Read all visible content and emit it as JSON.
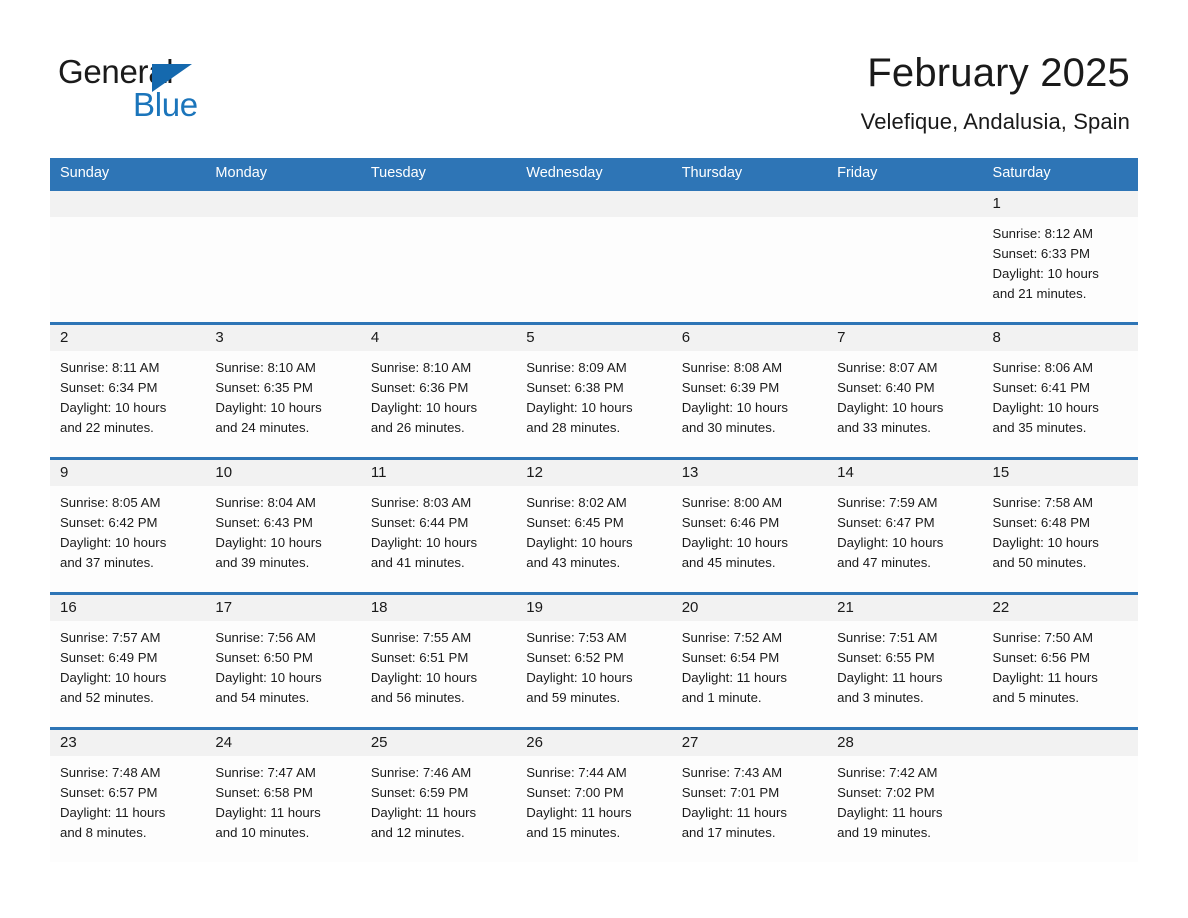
{
  "brand": {
    "name_part1": "General",
    "name_part2": "Blue",
    "colors": {
      "blue": "#1b75bb",
      "triangle": "#1569ae"
    }
  },
  "header": {
    "month_title": "February 2025",
    "location": "Velefique, Andalusia, Spain"
  },
  "theme": {
    "header_blue": "#2e75b6",
    "day_band_gray": "#f2f2f2",
    "text": "#1a1a1a"
  },
  "calendar": {
    "weekdays": [
      "Sunday",
      "Monday",
      "Tuesday",
      "Wednesday",
      "Thursday",
      "Friday",
      "Saturday"
    ],
    "weeks": [
      [
        {
          "day": "",
          "sunrise": "",
          "sunset": "",
          "daylight_line1": "",
          "daylight_line2": ""
        },
        {
          "day": "",
          "sunrise": "",
          "sunset": "",
          "daylight_line1": "",
          "daylight_line2": ""
        },
        {
          "day": "",
          "sunrise": "",
          "sunset": "",
          "daylight_line1": "",
          "daylight_line2": ""
        },
        {
          "day": "",
          "sunrise": "",
          "sunset": "",
          "daylight_line1": "",
          "daylight_line2": ""
        },
        {
          "day": "",
          "sunrise": "",
          "sunset": "",
          "daylight_line1": "",
          "daylight_line2": ""
        },
        {
          "day": "",
          "sunrise": "",
          "sunset": "",
          "daylight_line1": "",
          "daylight_line2": ""
        },
        {
          "day": "1",
          "sunrise": "Sunrise: 8:12 AM",
          "sunset": "Sunset: 6:33 PM",
          "daylight_line1": "Daylight: 10 hours",
          "daylight_line2": "and 21 minutes."
        }
      ],
      [
        {
          "day": "2",
          "sunrise": "Sunrise: 8:11 AM",
          "sunset": "Sunset: 6:34 PM",
          "daylight_line1": "Daylight: 10 hours",
          "daylight_line2": "and 22 minutes."
        },
        {
          "day": "3",
          "sunrise": "Sunrise: 8:10 AM",
          "sunset": "Sunset: 6:35 PM",
          "daylight_line1": "Daylight: 10 hours",
          "daylight_line2": "and 24 minutes."
        },
        {
          "day": "4",
          "sunrise": "Sunrise: 8:10 AM",
          "sunset": "Sunset: 6:36 PM",
          "daylight_line1": "Daylight: 10 hours",
          "daylight_line2": "and 26 minutes."
        },
        {
          "day": "5",
          "sunrise": "Sunrise: 8:09 AM",
          "sunset": "Sunset: 6:38 PM",
          "daylight_line1": "Daylight: 10 hours",
          "daylight_line2": "and 28 minutes."
        },
        {
          "day": "6",
          "sunrise": "Sunrise: 8:08 AM",
          "sunset": "Sunset: 6:39 PM",
          "daylight_line1": "Daylight: 10 hours",
          "daylight_line2": "and 30 minutes."
        },
        {
          "day": "7",
          "sunrise": "Sunrise: 8:07 AM",
          "sunset": "Sunset: 6:40 PM",
          "daylight_line1": "Daylight: 10 hours",
          "daylight_line2": "and 33 minutes."
        },
        {
          "day": "8",
          "sunrise": "Sunrise: 8:06 AM",
          "sunset": "Sunset: 6:41 PM",
          "daylight_line1": "Daylight: 10 hours",
          "daylight_line2": "and 35 minutes."
        }
      ],
      [
        {
          "day": "9",
          "sunrise": "Sunrise: 8:05 AM",
          "sunset": "Sunset: 6:42 PM",
          "daylight_line1": "Daylight: 10 hours",
          "daylight_line2": "and 37 minutes."
        },
        {
          "day": "10",
          "sunrise": "Sunrise: 8:04 AM",
          "sunset": "Sunset: 6:43 PM",
          "daylight_line1": "Daylight: 10 hours",
          "daylight_line2": "and 39 minutes."
        },
        {
          "day": "11",
          "sunrise": "Sunrise: 8:03 AM",
          "sunset": "Sunset: 6:44 PM",
          "daylight_line1": "Daylight: 10 hours",
          "daylight_line2": "and 41 minutes."
        },
        {
          "day": "12",
          "sunrise": "Sunrise: 8:02 AM",
          "sunset": "Sunset: 6:45 PM",
          "daylight_line1": "Daylight: 10 hours",
          "daylight_line2": "and 43 minutes."
        },
        {
          "day": "13",
          "sunrise": "Sunrise: 8:00 AM",
          "sunset": "Sunset: 6:46 PM",
          "daylight_line1": "Daylight: 10 hours",
          "daylight_line2": "and 45 minutes."
        },
        {
          "day": "14",
          "sunrise": "Sunrise: 7:59 AM",
          "sunset": "Sunset: 6:47 PM",
          "daylight_line1": "Daylight: 10 hours",
          "daylight_line2": "and 47 minutes."
        },
        {
          "day": "15",
          "sunrise": "Sunrise: 7:58 AM",
          "sunset": "Sunset: 6:48 PM",
          "daylight_line1": "Daylight: 10 hours",
          "daylight_line2": "and 50 minutes."
        }
      ],
      [
        {
          "day": "16",
          "sunrise": "Sunrise: 7:57 AM",
          "sunset": "Sunset: 6:49 PM",
          "daylight_line1": "Daylight: 10 hours",
          "daylight_line2": "and 52 minutes."
        },
        {
          "day": "17",
          "sunrise": "Sunrise: 7:56 AM",
          "sunset": "Sunset: 6:50 PM",
          "daylight_line1": "Daylight: 10 hours",
          "daylight_line2": "and 54 minutes."
        },
        {
          "day": "18",
          "sunrise": "Sunrise: 7:55 AM",
          "sunset": "Sunset: 6:51 PM",
          "daylight_line1": "Daylight: 10 hours",
          "daylight_line2": "and 56 minutes."
        },
        {
          "day": "19",
          "sunrise": "Sunrise: 7:53 AM",
          "sunset": "Sunset: 6:52 PM",
          "daylight_line1": "Daylight: 10 hours",
          "daylight_line2": "and 59 minutes."
        },
        {
          "day": "20",
          "sunrise": "Sunrise: 7:52 AM",
          "sunset": "Sunset: 6:54 PM",
          "daylight_line1": "Daylight: 11 hours",
          "daylight_line2": "and 1 minute."
        },
        {
          "day": "21",
          "sunrise": "Sunrise: 7:51 AM",
          "sunset": "Sunset: 6:55 PM",
          "daylight_line1": "Daylight: 11 hours",
          "daylight_line2": "and 3 minutes."
        },
        {
          "day": "22",
          "sunrise": "Sunrise: 7:50 AM",
          "sunset": "Sunset: 6:56 PM",
          "daylight_line1": "Daylight: 11 hours",
          "daylight_line2": "and 5 minutes."
        }
      ],
      [
        {
          "day": "23",
          "sunrise": "Sunrise: 7:48 AM",
          "sunset": "Sunset: 6:57 PM",
          "daylight_line1": "Daylight: 11 hours",
          "daylight_line2": "and 8 minutes."
        },
        {
          "day": "24",
          "sunrise": "Sunrise: 7:47 AM",
          "sunset": "Sunset: 6:58 PM",
          "daylight_line1": "Daylight: 11 hours",
          "daylight_line2": "and 10 minutes."
        },
        {
          "day": "25",
          "sunrise": "Sunrise: 7:46 AM",
          "sunset": "Sunset: 6:59 PM",
          "daylight_line1": "Daylight: 11 hours",
          "daylight_line2": "and 12 minutes."
        },
        {
          "day": "26",
          "sunrise": "Sunrise: 7:44 AM",
          "sunset": "Sunset: 7:00 PM",
          "daylight_line1": "Daylight: 11 hours",
          "daylight_line2": "and 15 minutes."
        },
        {
          "day": "27",
          "sunrise": "Sunrise: 7:43 AM",
          "sunset": "Sunset: 7:01 PM",
          "daylight_line1": "Daylight: 11 hours",
          "daylight_line2": "and 17 minutes."
        },
        {
          "day": "28",
          "sunrise": "Sunrise: 7:42 AM",
          "sunset": "Sunset: 7:02 PM",
          "daylight_line1": "Daylight: 11 hours",
          "daylight_line2": "and 19 minutes."
        },
        {
          "day": "",
          "sunrise": "",
          "sunset": "",
          "daylight_line1": "",
          "daylight_line2": ""
        }
      ]
    ]
  }
}
